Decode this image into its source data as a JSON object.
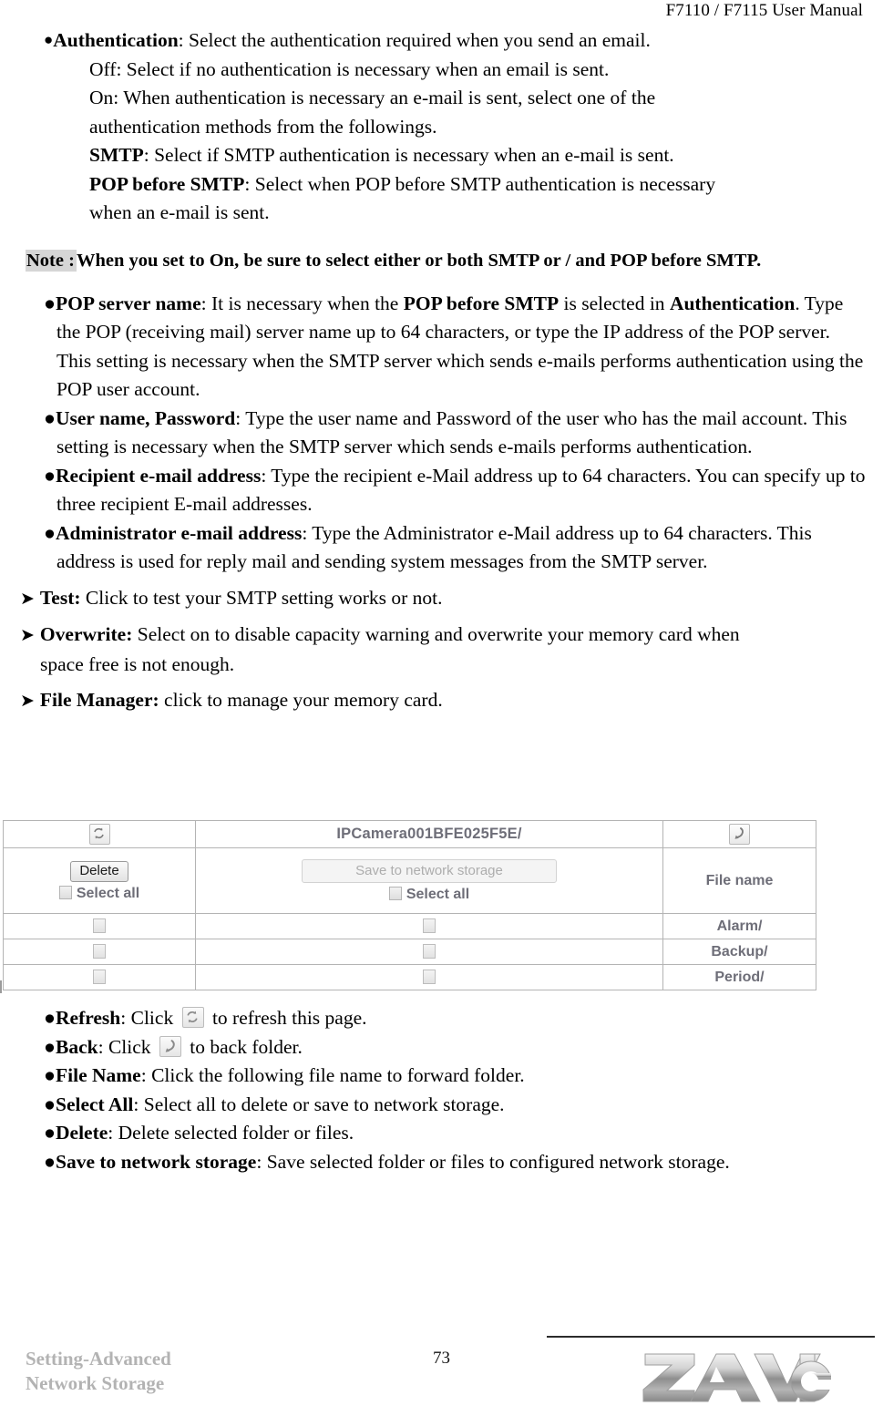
{
  "header": {
    "title": "F7110 / F7115 User Manual"
  },
  "content": {
    "authentication": {
      "term": "Authentication",
      "desc": ": Select the authentication required when you send an email.",
      "sub_lines": [
        "Off: Select if no authentication is necessary when an email is sent.",
        "On: When authentication is necessary an e-mail is sent, select one of the",
        "authentication methods from the followings."
      ],
      "smtp_term": "SMTP",
      "smtp_desc": ": Select if SMTP authentication is necessary when an e-mail is sent.",
      "pop_term": "POP before SMTP",
      "pop_desc": ": Select when POP before SMTP authentication is necessary",
      "pop_desc_2": "when an e-mail is sent."
    },
    "note": {
      "label": "Note :",
      "text": "When you set to On, be sure to select either or both SMTP or / and POP before SMTP."
    },
    "bullets": [
      {
        "term": "POP server name",
        "text_1": ": It is necessary when the ",
        "bold_mid": "POP before SMTP",
        "text_2": " is selected in ",
        "bold_mid_2": "Authentication",
        "text_3": ". Type the POP (receiving mail) server name up to 64 characters, or type the IP address of the POP server. This setting is necessary when the SMTP server which sends e-mails performs authentication using the POP user account."
      },
      {
        "term": "User name, Password",
        "text_1": ": Type the user name and Password of the user who has the mail account. This setting is necessary when the SMTP server which sends e-mails performs authentication."
      },
      {
        "term": "Recipient e-mail address",
        "text_1": ": Type the recipient e-Mail address up to 64 characters. You can specify up to three recipient E-mail addresses."
      },
      {
        "term": "Administrator e-mail address",
        "text_1": ": Type the Administrator e-Mail address up to 64 characters. This address is used for reply mail and sending system messages from the SMTP server."
      }
    ],
    "arrow_items": [
      {
        "term": "Test:",
        "text": " Click to test your SMTP setting works or not."
      },
      {
        "term": "Overwrite:",
        "text": " Select on to disable capacity warning and overwrite your memory card when",
        "cont": "space free is not enough."
      },
      {
        "term": "File Manager:",
        "text": " click to manage your memory card."
      }
    ]
  },
  "file_manager": {
    "refresh_icon": "refresh-icon",
    "back_icon": "back-arrow-icon",
    "path_title": "IPCamera001BFE025F5E/",
    "delete_label": "Delete",
    "save_label": "Save to network storage",
    "select_all_label": "Select all",
    "file_name_header": "File name",
    "rows": [
      {
        "name": "Alarm/"
      },
      {
        "name": "Backup/"
      },
      {
        "name": "Period/"
      }
    ]
  },
  "lower_bullets": [
    {
      "term": "Refresh",
      "pre": ": Click ",
      "icon": "refresh-icon",
      "post": " to refresh this page."
    },
    {
      "term": "Back",
      "pre": ": Click ",
      "icon": "back-arrow-icon",
      "post": " to back folder."
    },
    {
      "term": "File Name",
      "pre": ": Click the following file name to forward folder.",
      "icon": "",
      "post": ""
    },
    {
      "term": "Select All",
      "pre": ": Select all to delete or save to network storage.",
      "icon": "",
      "post": ""
    },
    {
      "term": "Delete",
      "pre": ": Delete selected folder or files.",
      "icon": "",
      "post": ""
    },
    {
      "term": "Save to network storage",
      "pre": ": Save selected folder or files to configured network storage.",
      "icon": "",
      "post": ""
    }
  ],
  "footer": {
    "section_line_1": "Setting-Advanced",
    "section_line_2": "Network Storage",
    "page_number": "73",
    "logo_text": "ZAVIO"
  }
}
